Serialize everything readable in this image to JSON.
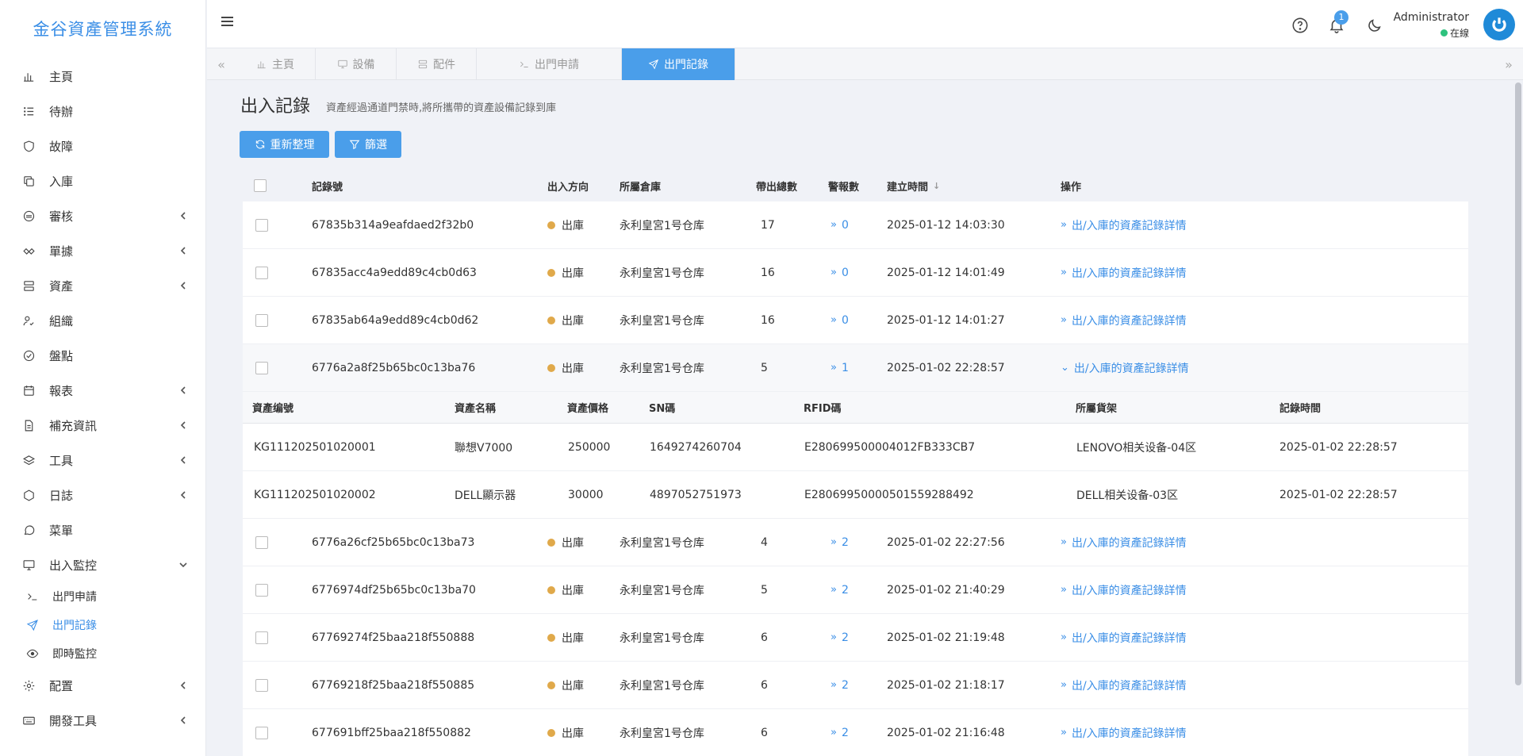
{
  "app": {
    "title": "金谷資產管理系統"
  },
  "sidebar": {
    "items": [
      {
        "label": "主頁",
        "icon": "bar-chart-icon"
      },
      {
        "label": "待辦",
        "icon": "list-icon"
      },
      {
        "label": "故障",
        "icon": "shield-icon"
      },
      {
        "label": "入庫",
        "icon": "copy-icon"
      },
      {
        "label": "審核",
        "icon": "audit-icon",
        "has_children": true
      },
      {
        "label": "單據",
        "icon": "handshake-icon",
        "has_children": true
      },
      {
        "label": "資產",
        "icon": "server-icon",
        "has_children": true
      },
      {
        "label": "組織",
        "icon": "user-check-icon"
      },
      {
        "label": "盤點",
        "icon": "check-circle-icon"
      },
      {
        "label": "報表",
        "icon": "calendar-icon",
        "has_children": true
      },
      {
        "label": "補充資訊",
        "icon": "file-icon",
        "has_children": true
      },
      {
        "label": "工具",
        "icon": "layers-icon",
        "has_children": true
      },
      {
        "label": "日誌",
        "icon": "hexagon-icon",
        "has_children": true
      },
      {
        "label": "菜單",
        "icon": "chat-icon"
      },
      {
        "label": "出入監控",
        "icon": "monitor-icon",
        "expanded": true
      }
    ],
    "submenu": [
      {
        "label": "出門申請",
        "icon": "terminal-icon"
      },
      {
        "label": "出門記錄",
        "icon": "send-icon",
        "active": true
      },
      {
        "label": "即時監控",
        "icon": "eye-icon"
      }
    ],
    "bottom_items": [
      {
        "label": "配置",
        "icon": "gear-icon",
        "has_children": true
      },
      {
        "label": "開發工具",
        "icon": "keyboard-icon",
        "has_children": true
      }
    ]
  },
  "header": {
    "notification_count": "1",
    "user_name": "Administrator",
    "user_status": "在線"
  },
  "tabs": [
    {
      "label": "主頁",
      "icon": "bar-chart-icon"
    },
    {
      "label": "設備",
      "icon": "monitor-icon"
    },
    {
      "label": "配件",
      "icon": "server-icon"
    },
    {
      "label": "出門申請",
      "icon": "terminal-icon"
    },
    {
      "label": "出門記錄",
      "icon": "send-icon",
      "active": true
    }
  ],
  "page": {
    "title": "出入記錄",
    "description": "資產經過通道門禁時,將所攜帶的資產設備記錄到庫",
    "refresh_label": "重新整理",
    "filter_label": "篩選"
  },
  "table": {
    "columns": [
      "記錄號",
      "出入方向",
      "所屬倉庫",
      "帶出總數",
      "警報數",
      "建立時間",
      "操作"
    ],
    "rows": [
      {
        "id": "67835b314a9eafdaed2f32b0",
        "direction": "出庫",
        "warehouse": "永利皇宮1号仓库",
        "total": "17",
        "alarms": "0",
        "created": "2025-01-12 14:03:30",
        "action": "出/入庫的資產記錄詳情"
      },
      {
        "id": "67835acc4a9edd89c4cb0d63",
        "direction": "出庫",
        "warehouse": "永利皇宮1号仓库",
        "total": "16",
        "alarms": "0",
        "created": "2025-01-12 14:01:49",
        "action": "出/入庫的資產記錄詳情"
      },
      {
        "id": "67835ab64a9edd89c4cb0d62",
        "direction": "出庫",
        "warehouse": "永利皇宮1号仓库",
        "total": "16",
        "alarms": "0",
        "created": "2025-01-12 14:01:27",
        "action": "出/入庫的資產記錄詳情"
      },
      {
        "id": "6776a2a8f25b65bc0c13ba76",
        "direction": "出庫",
        "warehouse": "永利皇宮1号仓库",
        "total": "5",
        "alarms": "1",
        "created": "2025-01-02 22:28:57",
        "action": "出/入庫的資產記錄詳情",
        "expanded": true
      },
      {
        "id": "6776a26cf25b65bc0c13ba73",
        "direction": "出庫",
        "warehouse": "永利皇宮1号仓库",
        "total": "4",
        "alarms": "2",
        "created": "2025-01-02 22:27:56",
        "action": "出/入庫的資產記錄詳情"
      },
      {
        "id": "6776974df25b65bc0c13ba70",
        "direction": "出庫",
        "warehouse": "永利皇宮1号仓库",
        "total": "5",
        "alarms": "2",
        "created": "2025-01-02 21:40:29",
        "action": "出/入庫的資產記錄詳情"
      },
      {
        "id": "67769274f25baa218f550888",
        "direction": "出庫",
        "warehouse": "永利皇宮1号仓库",
        "total": "6",
        "alarms": "2",
        "created": "2025-01-02 21:19:48",
        "action": "出/入庫的資產記錄詳情"
      },
      {
        "id": "67769218f25baa218f550885",
        "direction": "出庫",
        "warehouse": "永利皇宮1号仓库",
        "total": "6",
        "alarms": "2",
        "created": "2025-01-02 21:18:17",
        "action": "出/入庫的資產記錄詳情"
      },
      {
        "id": "677691bff25baa218f550882",
        "direction": "出庫",
        "warehouse": "永利皇宮1号仓库",
        "total": "6",
        "alarms": "2",
        "created": "2025-01-02 21:16:48",
        "action": "出/入庫的資產記錄詳情"
      }
    ]
  },
  "detail": {
    "columns": [
      "資產编號",
      "資產名稱",
      "資產價格",
      "SN碼",
      "RFID碼",
      "所屬貨架",
      "記錄時間"
    ],
    "rows": [
      {
        "code": "KG111202501020001",
        "name": "聯想V7000",
        "price": "250000",
        "sn": "1649274260704",
        "rfid": "E280699500004012FB333CB7",
        "shelf": "LENOVO相关设备-04区",
        "time": "2025-01-02 22:28:57"
      },
      {
        "code": "KG111202501020002",
        "name": "DELL顯示器",
        "price": "30000",
        "sn": "4897052751973",
        "rfid": "E28069950000501559288492",
        "shelf": "DELL相关设备-03区",
        "time": "2025-01-02 22:28:57"
      }
    ]
  },
  "colors": {
    "accent": "#4a9eea",
    "direction_dot": "#e0a94a",
    "online": "#2ec27e"
  }
}
